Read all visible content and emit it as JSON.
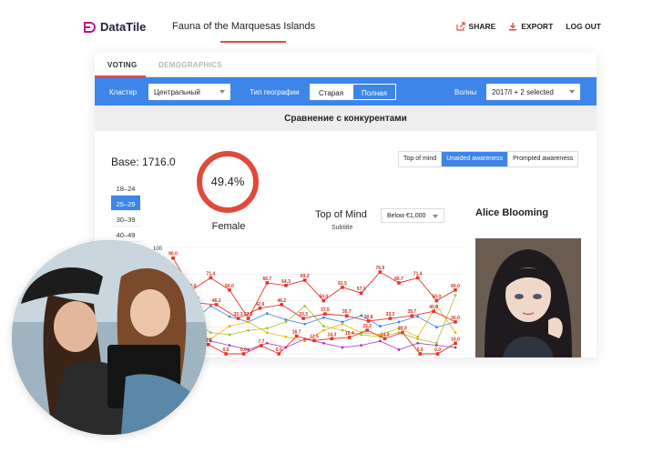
{
  "app": {
    "brand": "DataTile",
    "page_title": "Fauna of the Marquesas Islands",
    "actions": {
      "share": "SHARE",
      "export": "EXPORT",
      "logout": "LOG OUT"
    },
    "accent_color": "#e04a3a"
  },
  "tabs": [
    {
      "label": "VOTING",
      "active": true
    },
    {
      "label": "DEMOGRAPHICS",
      "active": false
    }
  ],
  "filters": {
    "cluster_label": "Кластер",
    "cluster_value": "Центральный",
    "geo_label": "Тип географии",
    "geo_options": [
      "Старая",
      "Полная"
    ],
    "geo_selected": "Старая",
    "waves_label": "Волны",
    "waves_value": "2017/I + 2 selected",
    "bar_color": "#3d85e8"
  },
  "section_title": "Сравнение с конкурентами",
  "base": "Base: 1716.0",
  "age_groups": [
    {
      "label": "18–24",
      "active": false
    },
    {
      "label": "25–29",
      "active": true
    },
    {
      "label": "30–39",
      "active": false
    },
    {
      "label": "40–49",
      "active": false
    }
  ],
  "gauge": {
    "value_label": "49.4%",
    "fraction": 0.494,
    "caption": "Female"
  },
  "awareness_tabs": {
    "items": [
      "Top of mind",
      "Unaided awareness",
      "Prompted awareness"
    ],
    "selected": "Unaided awareness"
  },
  "tom_panel": {
    "title": "Top of Mind",
    "subtitle": "Subtitle",
    "price_filter": "Below €1,000"
  },
  "person": {
    "name": "Alice Blooming"
  },
  "chart_data": {
    "type": "line",
    "ylim": [
      0,
      100
    ],
    "y_tick_label": "100",
    "grid": true,
    "series": [
      {
        "color": "#e8332a",
        "values": [
          90.0,
          60.0,
          71.4,
          60.0,
          33.3,
          66.7,
          64.3,
          69.2,
          50.0,
          62.5,
          57.1,
          76.9,
          66.7,
          71.4,
          50.0,
          60.0
        ],
        "labels": [
          "90.0",
          "60.0",
          "71.4",
          "60.0",
          "33.3",
          "66.7",
          "64.3",
          "69.2",
          "50.0",
          "62.5",
          "57.1",
          "76.9",
          "66.7",
          "71.4",
          "50.0",
          "60.0"
        ]
      },
      {
        "color": "#e8332a",
        "values": [
          60.0,
          47.9,
          46.2,
          33.3,
          42.9,
          46.2,
          33.3,
          37.5,
          35.7,
          30.8,
          33.3,
          35.7,
          40.0,
          30.0
        ],
        "labels": [
          "60.0",
          "47.9",
          "46.2",
          "33.3",
          "42.9",
          "46.2",
          "33.3",
          "37.5",
          "35.7",
          "30.8",
          "33.3",
          "35.7",
          "40.0",
          "30.0"
        ]
      },
      {
        "color": "#e8332a",
        "values": [
          33.4,
          26.7,
          8.7,
          0.0,
          0.0,
          7.7,
          0.0,
          16.7,
          12.5,
          14.3,
          15.4,
          22.2,
          14.3,
          20.0,
          0.0,
          0.0,
          10.0
        ],
        "labels": [
          "33.4",
          "26.7",
          "8.7",
          "0.0",
          "0.0",
          "7.7",
          "0.0",
          "16.7",
          "12.5",
          "14.3",
          "15.4",
          "22.2",
          "14.3",
          "20.0",
          "0.0",
          "0.0",
          "10.0"
        ]
      },
      {
        "color": "#3d85e8",
        "values": [
          40,
          30,
          45,
          35,
          30,
          38,
          32,
          28,
          34,
          30,
          36,
          26,
          30,
          35,
          25,
          30
        ]
      },
      {
        "color": "#a8c52a",
        "values": [
          28,
          32,
          20,
          18,
          22,
          24,
          30,
          45,
          26,
          22,
          18,
          16,
          20,
          14,
          10,
          55
        ]
      },
      {
        "color": "#f0b400",
        "values": [
          22,
          18,
          14,
          26,
          30,
          20,
          16,
          12,
          22,
          28,
          20,
          18,
          24,
          16,
          45,
          20
        ]
      },
      {
        "color": "#a53ac2",
        "values": [
          18,
          24,
          12,
          8,
          4,
          10,
          6,
          14,
          10,
          6,
          8,
          12,
          4,
          10,
          8,
          6
        ]
      }
    ]
  }
}
